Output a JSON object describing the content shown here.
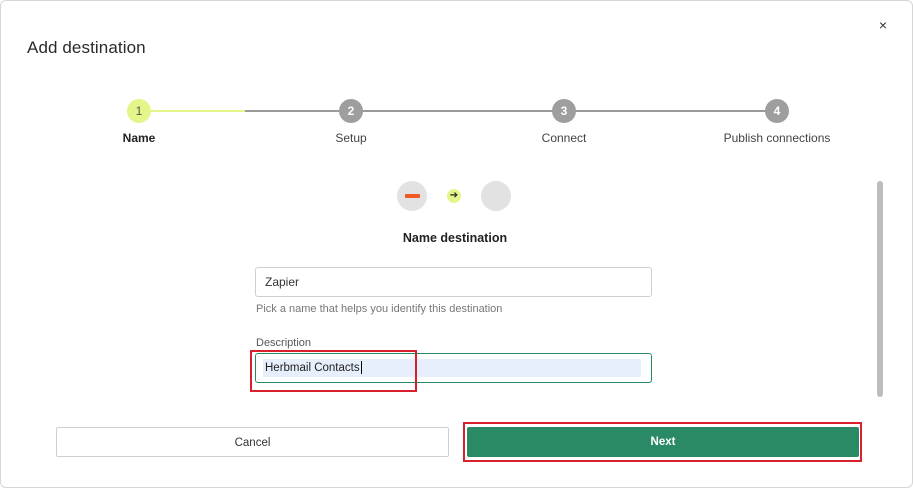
{
  "dialog": {
    "title": "Add destination",
    "close_icon": "×"
  },
  "stepper": {
    "steps": [
      {
        "number": "1",
        "label": "Name",
        "state": "active"
      },
      {
        "number": "2",
        "label": "Setup",
        "state": "pending"
      },
      {
        "number": "3",
        "label": "Connect",
        "state": "pending"
      },
      {
        "number": "4",
        "label": "Publish connections",
        "state": "pending"
      }
    ]
  },
  "connector": {
    "source_icon": "source-logo-icon",
    "arrow_icon": "➔",
    "destination_icon": "destination-placeholder-icon",
    "source_color": "#f05a22"
  },
  "form": {
    "section_title": "Name destination",
    "name_value": "Zapier",
    "name_hint": "Pick a name that helps you identify this destination",
    "description_label": "Description",
    "description_value": "Herbmail Contacts"
  },
  "actions": {
    "cancel_label": "Cancel",
    "next_label": "Next"
  },
  "colors": {
    "accent": "#2b8a66",
    "step_active": "#e4f58a",
    "highlight": "#d9202f"
  }
}
